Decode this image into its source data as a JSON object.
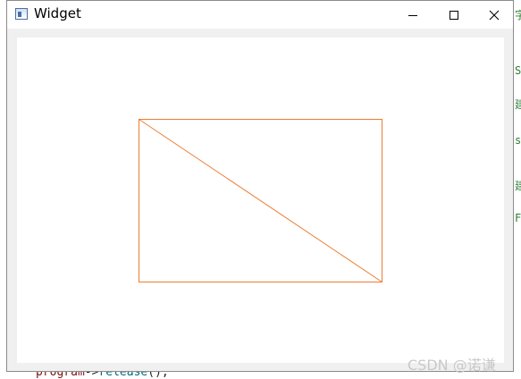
{
  "window": {
    "title": "Widget",
    "minimize_icon": "minimize-icon",
    "maximize_icon": "maximize-icon",
    "close_icon": "close-icon"
  },
  "canvas": {
    "stroke_color": "#ed7d31",
    "shapes": [
      "rectangle-outline",
      "diagonal-line"
    ]
  },
  "background_code": {
    "object": "program",
    "operator": "->",
    "call": "release",
    "tail": "();"
  },
  "background_glyphs": [
    "字",
    "SI",
    "建",
    "s",
    "建",
    "F"
  ],
  "watermark": "CSDN @诺谦"
}
